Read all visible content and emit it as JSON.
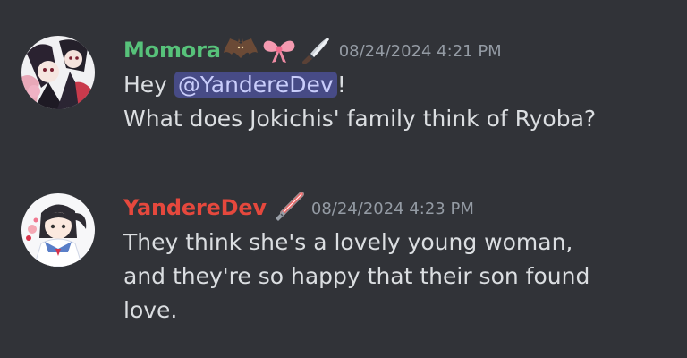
{
  "messages": [
    {
      "author": "Momora",
      "author_color": "#57c27a",
      "decorations": [
        "bat-icon",
        "bow-icon",
        "knife-icon"
      ],
      "timestamp": "08/24/2024 4:21 PM",
      "greeting": "Hey ",
      "mention": "@YandereDev",
      "after_mention": "!",
      "line2": "What does Jokichis' family think of Ryoba?"
    },
    {
      "author": "YandereDev",
      "author_color": "#e5483d",
      "decorations": [
        "lightsaber-icon"
      ],
      "timestamp": "08/24/2024 4:23 PM",
      "lines": [
        "They think she's a lovely young woman,",
        "and they're so happy that their son found",
        "love."
      ]
    }
  ],
  "colors": {
    "background": "#313338",
    "text": "#dbdee1",
    "timestamp": "#949ba4",
    "mention_bg": "#474b86",
    "mention_text": "#c9cdfb"
  }
}
